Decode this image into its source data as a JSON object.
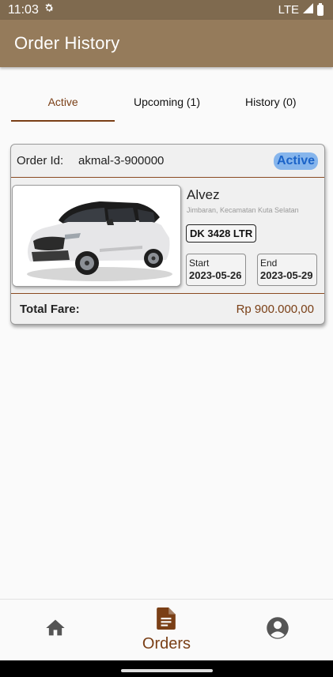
{
  "status": {
    "time": "11:03",
    "network": "LTE",
    "icons": [
      "settings-icon",
      "signal-icon",
      "battery-icon"
    ]
  },
  "app_bar": {
    "title": "Order History"
  },
  "tabs": [
    {
      "label": "Active",
      "selected": true
    },
    {
      "label": "Upcoming (1)",
      "selected": false
    },
    {
      "label": "History (0)",
      "selected": false
    }
  ],
  "order": {
    "id_label": "Order Id:",
    "id_value": "akmal-3-900000",
    "status_badge": "Active",
    "car_name": "Alvez",
    "location": "Jimbaran, Kecamatan Kuta Selatan",
    "plate": "DK 3428 LTR",
    "start_label": "Start",
    "start_date": "2023-05-26",
    "end_label": "End",
    "end_date": "2023-05-29",
    "fare_label": "Total Fare:",
    "fare_value": "Rp 900.000,00"
  },
  "bottom_nav": {
    "items": [
      {
        "icon": "home-icon",
        "label": ""
      },
      {
        "icon": "document-icon",
        "label": "Orders",
        "selected": true
      },
      {
        "icon": "account-icon",
        "label": ""
      }
    ]
  },
  "colors": {
    "accent": "#7a3f16",
    "app_bar": "#957b5b",
    "status_bar": "#7f6a4f",
    "badge_bg": "#86b5ec",
    "badge_text": "#1b63c8"
  }
}
